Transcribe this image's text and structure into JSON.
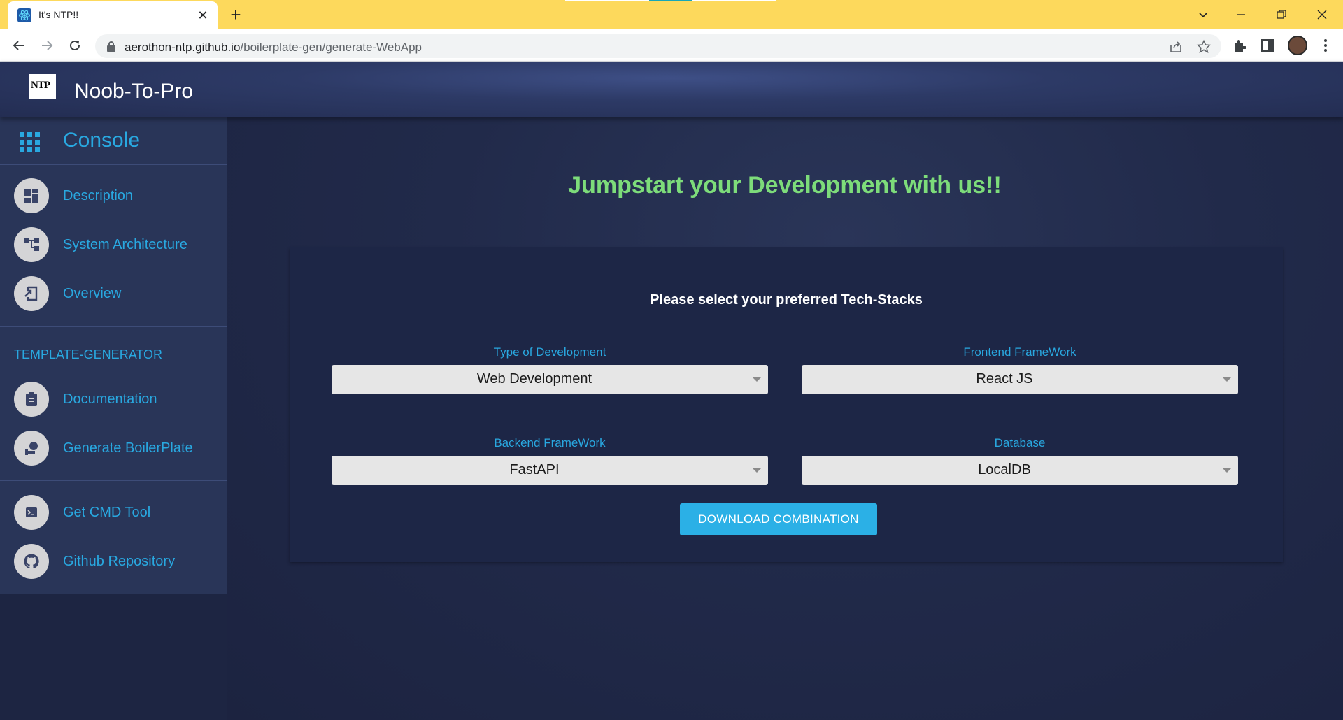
{
  "browser": {
    "tab_title": "It's NTP!!",
    "url_host": "aerothon-ntp.github.io",
    "url_path": "/boilerplate-gen/generate-WebApp",
    "tab_close_glyph": "✕",
    "new_tab_glyph": "+"
  },
  "header": {
    "logo_text": "NTP",
    "app_title": "Noob-To-Pro"
  },
  "sidebar": {
    "console_label": "Console",
    "items": [
      {
        "label": "Description",
        "icon": "dashboard-icon"
      },
      {
        "label": "System Architecture",
        "icon": "architecture-icon"
      },
      {
        "label": "Overview",
        "icon": "overview-icon"
      }
    ],
    "section_title": "TEMPLATE-GENERATOR",
    "generator_items": [
      {
        "label": "Documentation",
        "icon": "clipboard-icon"
      },
      {
        "label": "Generate BoilerPlate",
        "icon": "generate-icon"
      }
    ],
    "extra_items": [
      {
        "label": "Get CMD Tool",
        "icon": "terminal-icon"
      },
      {
        "label": "Github Repository",
        "icon": "github-icon"
      }
    ]
  },
  "main": {
    "hero_title": "Jumpstart your Development with us!!",
    "card_title": "Please select your preferred Tech-Stacks",
    "fields": [
      {
        "label": "Type of Development",
        "value": "Web Development"
      },
      {
        "label": "Frontend FrameWork",
        "value": "React JS"
      },
      {
        "label": "Backend FrameWork",
        "value": "FastAPI"
      },
      {
        "label": "Database",
        "value": "LocalDB"
      }
    ],
    "download_label": "DOWNLOAD COMBINATION"
  },
  "colors": {
    "accent": "#29a8e0",
    "hero_green": "#7ddc7a",
    "tabbar": "#fdd95c",
    "button": "#2bb0e6"
  }
}
